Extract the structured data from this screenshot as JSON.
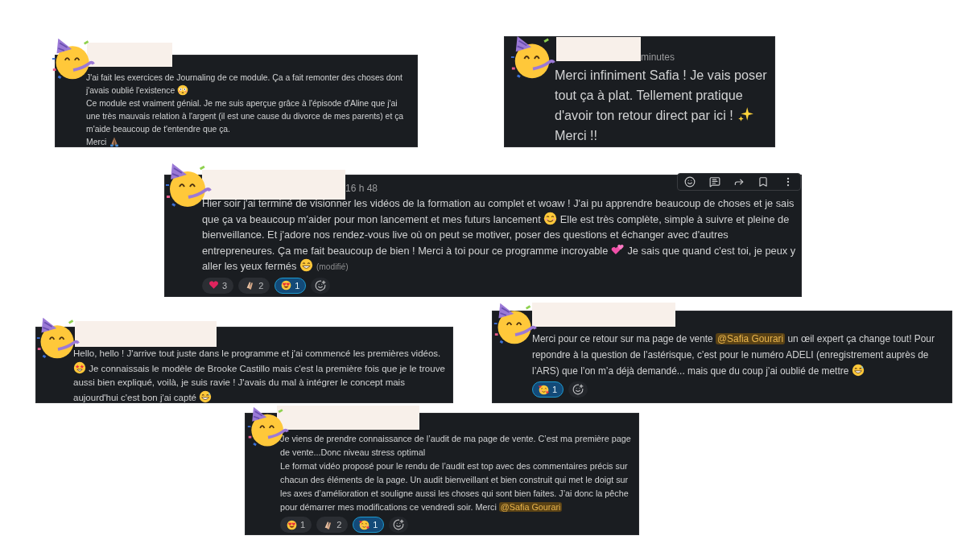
{
  "messages": [
    {
      "paragraphs": [
        [
          {
            "kind": "text",
            "text": "J'ai fait les exercices de Journaling de ce module. Ça a fait remonter des choses dont j'avais oublié l'existence "
          },
          {
            "kind": "flushed"
          }
        ],
        [
          {
            "kind": "text",
            "text": "Ce module est vraiment génial. Je me suis aperçue grâce à l'épisode d'Aline que j'ai une très mauvais relation à l'argent (il est une cause du divorce de mes parents) et ça m'aide beaucoup de t'entendre que ça."
          }
        ],
        [
          {
            "kind": "text",
            "text": "Merci "
          },
          {
            "kind": "pray"
          }
        ]
      ]
    },
    {
      "timestamp": "minutes",
      "paragraphs": [
        [
          {
            "kind": "text",
            "text": "Merci infiniment Safia ! Je vais poser tout ça à plat. Tellement pratique d'avoir ton retour direct par ici ! "
          },
          {
            "kind": "sparkles"
          },
          {
            "kind": "text",
            "text": " Merci !!"
          }
        ]
      ]
    },
    {
      "timestamp": "16 h 48",
      "hover_toolbar": true,
      "paragraphs": [
        [
          {
            "kind": "text",
            "text": "Hier soir j'ai terminé de visionner les vidéos de la formation  au complet et woaw ! J'ai pu apprendre beaucoup de choses et je sais que ça va beaucoup m'aider pour mon lancement et mes futurs lancement "
          },
          {
            "kind": "smile"
          },
          {
            "kind": "text",
            "text": " Elle est très complète, simple à suivre et pleine de bienveillance. Et j'adore nos rendez-vous live où on peut se motiver, poser des questions et échanger avec d'autres entrepreneures. Ça me fait beaucoup de bien ! Merci à toi pour ce programme incroyable "
          },
          {
            "kind": "two-hearts"
          },
          {
            "kind": "text",
            "text": " Je sais que quand c'est toi, je peux y aller les yeux fermés "
          },
          {
            "kind": "grin"
          },
          {
            "kind": "edited",
            "text": "(modifié)"
          }
        ]
      ],
      "reactions": [
        {
          "kind": "heart",
          "count": "3",
          "selected": false
        },
        {
          "kind": "clap",
          "count": "2",
          "selected": false
        },
        {
          "kind": "heart-eyes",
          "count": "1",
          "selected": true
        }
      ]
    },
    {
      "paragraphs": [
        [
          {
            "kind": "text",
            "text": "Hello, hello ! J'arrive tout juste dans le programme et j'ai commencé les premières vidéos. "
          },
          {
            "kind": "star-struck"
          },
          {
            "kind": "text",
            "text": " Je connaissais le modèle de Brooke Castillo mais c'est la première fois que je le trouve aussi bien expliqué, voilà, je suis ravie ! J'avais du mal à intégrer le concept mais aujourd'hui c'est bon j'ai capté "
          },
          {
            "kind": "sweat-smile"
          }
        ]
      ]
    },
    {
      "paragraphs": [
        [
          {
            "kind": "text",
            "text": "Merci pour ce retour sur ma page de vente "
          },
          {
            "kind": "mention",
            "text": "@Safia Gourari"
          },
          {
            "kind": "text",
            "text": " un œil expert ça change tout! Pour repondre à la question de l’astérisque, c’est pour le numéro ADELI (enregistrement auprès de l’ARS)  que l’on m’a déjà demandé... mais que du coup j’ai oublié de mettre "
          },
          {
            "kind": "sweat-smile"
          }
        ]
      ],
      "reactions": [
        {
          "kind": "smiling-hearts",
          "count": "1",
          "selected": true
        }
      ]
    },
    {
      "paragraphs": [
        [
          {
            "kind": "text",
            "text": "Je viens de prendre connaissance de l’audit de ma page de vente. C’est ma première page de vente...Donc niveau stress optimal"
          }
        ],
        [
          {
            "kind": "text",
            "text": "Le format vidéo proposé  pour le rendu de l’audit est top avec des commentaires précis sur chacun des éléments de la page. Un audit bienveillant et bien construit qui met le doigt sur les  axes d’amélioration et souligne aussi les choses qui sont bien faites. J’ai donc la pêche pour démarrer mes modifications ce vendredi soir. Merci "
          },
          {
            "kind": "mention",
            "text": "@Safia Gourari"
          }
        ]
      ],
      "reactions": [
        {
          "kind": "heart-eyes",
          "count": "1",
          "selected": false
        },
        {
          "kind": "clap",
          "count": "2",
          "selected": false
        },
        {
          "kind": "smiling-hearts",
          "count": "1",
          "selected": true
        }
      ]
    }
  ]
}
